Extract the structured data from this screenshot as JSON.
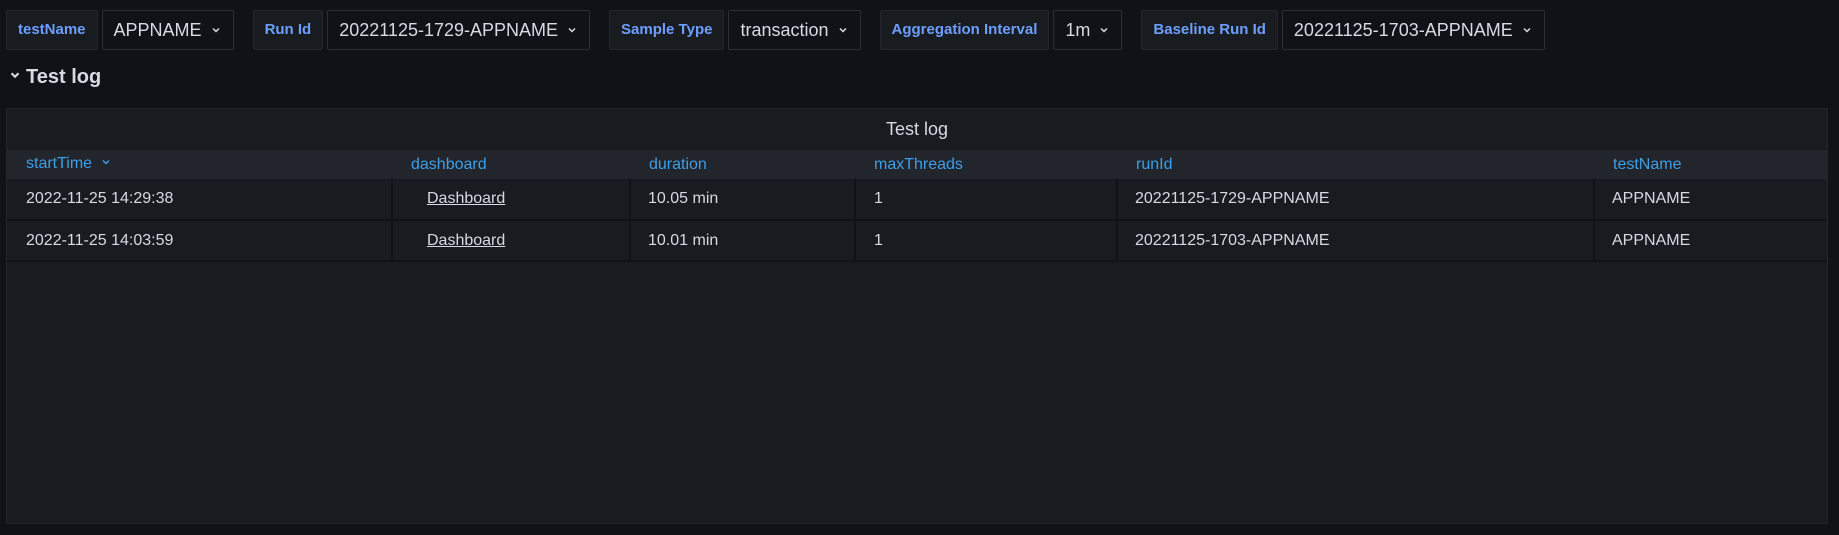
{
  "variables": [
    {
      "label": "testName",
      "value": "APPNAME"
    },
    {
      "label": "Run Id",
      "value": "20221125-1729-APPNAME"
    },
    {
      "label": "Sample Type",
      "value": "transaction"
    },
    {
      "label": "Aggregation Interval",
      "value": "1m"
    },
    {
      "label": "Baseline Run Id",
      "value": "20221125-1703-APPNAME"
    }
  ],
  "row": {
    "title": "Test log",
    "icon": "chevron-down-icon"
  },
  "panel": {
    "title": "Test log",
    "columns": [
      "startTime",
      "dashboard",
      "duration",
      "maxThreads",
      "runId",
      "testName"
    ],
    "sorted_column": "startTime",
    "rows": [
      [
        "2022-11-25 14:29:38",
        "Dashboard",
        "10.05 min",
        "1",
        "20221125-1729-APPNAME",
        "APPNAME"
      ],
      [
        "2022-11-25 14:03:59",
        "Dashboard",
        "10.01 min",
        "1",
        "20221125-1703-APPNAME",
        "APPNAME"
      ]
    ]
  },
  "colors": {
    "background": "#111217",
    "panel": "#181b1f",
    "label_text": "#6e9fff",
    "header_text": "#3d9fe8"
  }
}
